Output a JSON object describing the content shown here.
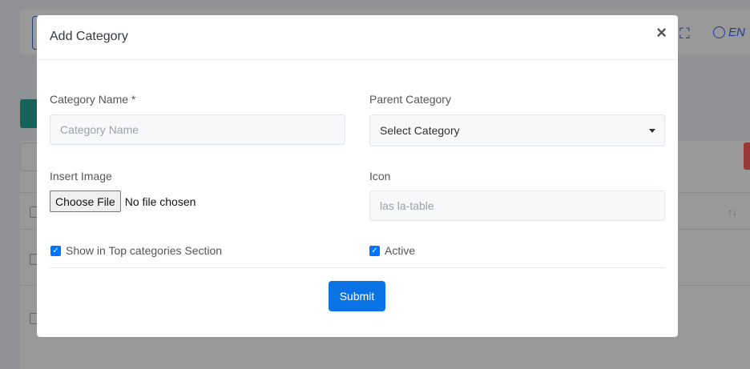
{
  "background": {
    "language_label": "EN"
  },
  "modal": {
    "title": "Add Category",
    "close_symbol": "×",
    "category_name": {
      "label": "Category Name *",
      "placeholder": "Category Name",
      "value": ""
    },
    "parent_category": {
      "label": "Parent Category",
      "selected": "Select Category"
    },
    "insert_image": {
      "label": "Insert Image",
      "button": "Choose File",
      "status": "No file chosen"
    },
    "icon": {
      "label": "Icon",
      "placeholder": "las la-table",
      "value": ""
    },
    "show_top_categories": {
      "label": "Show in Top categories Section",
      "checked": true
    },
    "active": {
      "label": "Active",
      "checked": true
    },
    "submit_label": "Submit"
  },
  "colors": {
    "primary": "#0a74e6",
    "checkbox": "#0075ff"
  }
}
